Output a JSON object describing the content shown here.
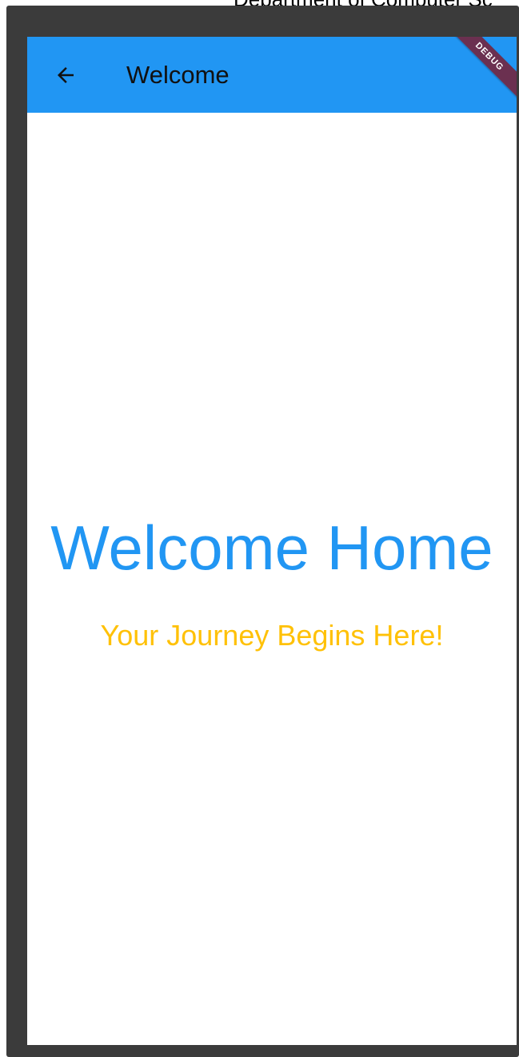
{
  "background_document": {
    "partial_text": "Department of Computer Sc"
  },
  "app_bar": {
    "title": "Welcome",
    "back_icon": "arrow-back-icon",
    "color": "#2196f3"
  },
  "debug_banner": {
    "label": "DEBUG"
  },
  "main": {
    "headline": "Welcome Home",
    "headline_color": "#2196f3",
    "subtitle": "Your Journey Begins Here!",
    "subtitle_color": "#ffc107"
  }
}
